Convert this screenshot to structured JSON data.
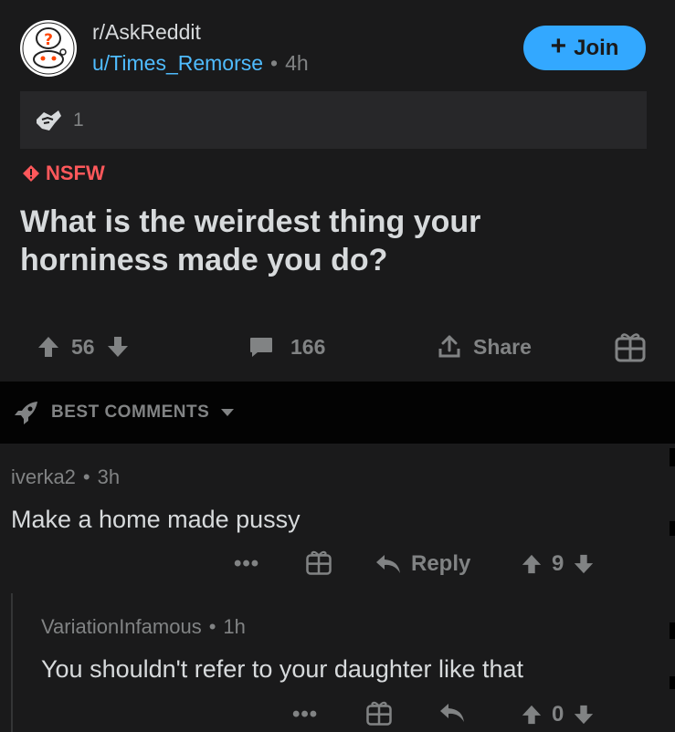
{
  "post": {
    "subreddit": "r/AskReddit",
    "author": "u/Times_Remorse",
    "age": "4h",
    "join_label": "Join",
    "award_count": "1",
    "nsfw_label": "NSFW",
    "title": "What is the weirdest thing your horniness made you do?",
    "votes": "56",
    "comments": "166",
    "share_label": "Share"
  },
  "sort": {
    "label": "BEST COMMENTS"
  },
  "comments": [
    {
      "author": "iverka2",
      "age": "3h",
      "body": "Make a home made pussy",
      "reply_label": "Reply",
      "votes": "9"
    },
    {
      "author": "VariationInfamous",
      "age": "1h",
      "body": "You shouldn't refer to your daughter like that",
      "votes": "0"
    }
  ],
  "colors": {
    "accent": "#33a8ff",
    "nsfw": "#ff585b",
    "link": "#4fbcff",
    "bg": "#1a1a1b"
  }
}
